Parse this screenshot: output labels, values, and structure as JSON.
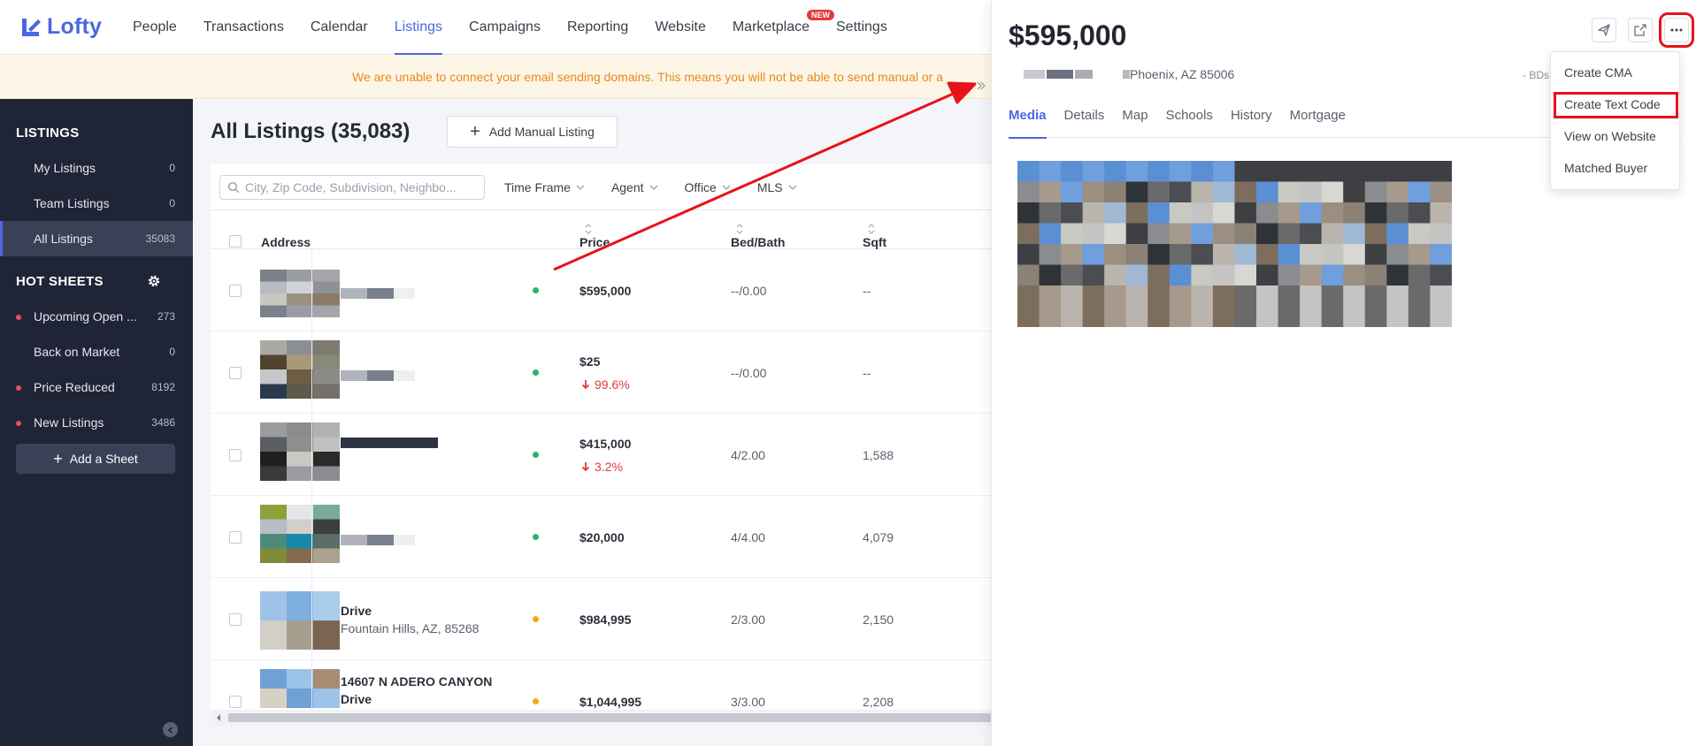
{
  "app": {
    "logo_text": "Lofty"
  },
  "nav": {
    "items": [
      "People",
      "Transactions",
      "Calendar",
      "Listings",
      "Campaigns",
      "Reporting",
      "Website",
      "Marketplace",
      "Settings"
    ],
    "active": "Listings",
    "new_badge": "NEW"
  },
  "banner": {
    "text": "We are unable to connect your email sending domains. This means you will not be able to send manual or a"
  },
  "sidebar": {
    "listings_heading": "LISTINGS",
    "listings": [
      {
        "label": "My Listings",
        "count": "0"
      },
      {
        "label": "Team Listings",
        "count": "0"
      },
      {
        "label": "All Listings",
        "count": "35083"
      }
    ],
    "hotsheets_heading": "HOT SHEETS",
    "hotsheets": [
      {
        "label": "Upcoming Open ...",
        "count": "273"
      },
      {
        "label": "Back on Market",
        "count": "0"
      },
      {
        "label": "Price Reduced",
        "count": "8192"
      },
      {
        "label": "New Listings",
        "count": "3486"
      }
    ],
    "add_sheet_label": "Add a Sheet"
  },
  "main": {
    "title": "All Listings (35,083)",
    "add_listing_label": "Add Manual Listing",
    "search_placeholder": "City, Zip Code, Subdivision, Neighbo...",
    "filters": [
      "Time Frame",
      "Agent",
      "Office",
      "MLS"
    ],
    "columns": {
      "address": "Address",
      "price": "Price",
      "bedbath": "Bed/Bath",
      "sqft": "Sqft"
    },
    "rows": [
      {
        "addr1": "",
        "addr2": "",
        "price": "$595,000",
        "change": "",
        "bedbath": "--/0.00",
        "sqft": "--",
        "status": "#29b36b"
      },
      {
        "addr1": "",
        "addr2": "",
        "price": "$25",
        "change": "99.6%",
        "bedbath": "--/0.00",
        "sqft": "--",
        "status": "#29b36b"
      },
      {
        "addr1": "",
        "addr2": "",
        "price": "$415,000",
        "change": "3.2%",
        "bedbath": "4/2.00",
        "sqft": "1,588",
        "status": "#29b36b"
      },
      {
        "addr1": "",
        "addr2": "",
        "price": "$20,000",
        "change": "",
        "bedbath": "4/4.00",
        "sqft": "4,079",
        "status": "#29b36b"
      },
      {
        "addr1": "Drive",
        "addr2": "Fountain Hills, AZ, 85268",
        "price": "$984,995",
        "change": "",
        "bedbath": "2/3.00",
        "sqft": "2,150",
        "status": "#f2a81d"
      },
      {
        "addr1": "14607 N ADERO CANYON",
        "addr2": "Drive",
        "price": "$1,044,995",
        "change": "",
        "bedbath": "3/3.00",
        "sqft": "2,208",
        "status": "#f2a81d"
      }
    ]
  },
  "panel": {
    "price": "$595,000",
    "address": "Phoenix, AZ 85006",
    "bds_label": "- BDs",
    "tabs": [
      "Media",
      "Details",
      "Map",
      "Schools",
      "History",
      "Mortgage"
    ],
    "active_tab": "Media",
    "menu": [
      "Create CMA",
      "Create Text Code",
      "View on Website",
      "Matched Buyer"
    ]
  },
  "colors": {
    "accent": "#4c67e0",
    "sidebar_bg": "#1f2536",
    "highlight": "#e8121a",
    "warning_text": "#e8891c"
  }
}
